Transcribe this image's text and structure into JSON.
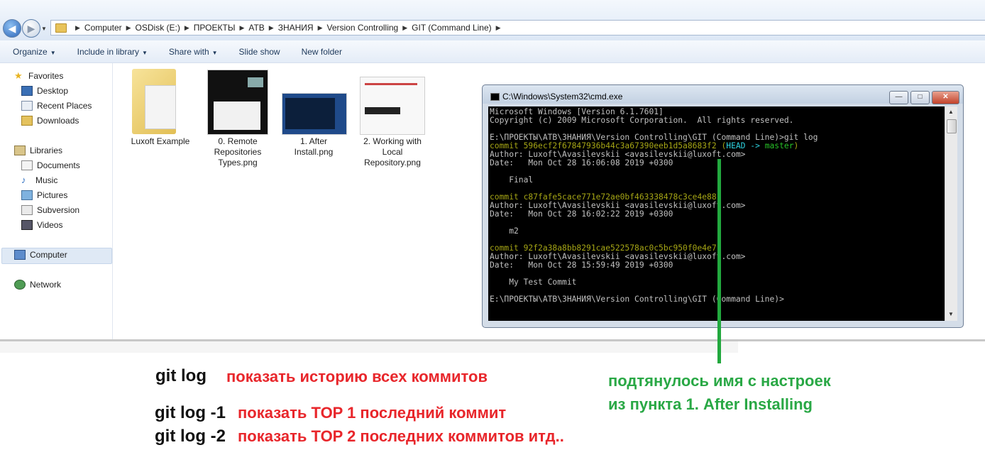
{
  "explorer": {
    "breadcrumb": [
      "Computer",
      "OSDisk (E:)",
      "ПРОЕКТЫ",
      "АТВ",
      "ЗНАНИЯ",
      "Version Controlling",
      "GIT (Command Line)"
    ],
    "toolbar": {
      "organize": "Organize",
      "include_in_library": "Include in library",
      "share_with": "Share with",
      "slide_show": "Slide show",
      "new_folder": "New folder"
    },
    "sidebar": {
      "favorites": "Favorites",
      "desktop": "Desktop",
      "recent_places": "Recent Places",
      "downloads": "Downloads",
      "libraries": "Libraries",
      "documents": "Documents",
      "music": "Music",
      "pictures": "Pictures",
      "subversion": "Subversion",
      "videos": "Videos",
      "computer": "Computer",
      "network": "Network"
    },
    "files": {
      "f0": {
        "line1": "Luxoft Example",
        "line2": "",
        "line3": ""
      },
      "f1": {
        "line1": "0. Remote",
        "line2": "Repositories",
        "line3": "Types.png"
      },
      "f2": {
        "line1": "1. After",
        "line2": "Install.png",
        "line3": ""
      },
      "f3": {
        "line1": "2. Working with",
        "line2": "Local",
        "line3": "Repository.png"
      }
    }
  },
  "cmd": {
    "title": "C:\\Windows\\System32\\cmd.exe",
    "lines": {
      "l1": "Microsoft Windows [Version 6.1.7601]",
      "l2": "Copyright (c) 2009 Microsoft Corporation.  All rights reserved.",
      "l3": "E:\\ПРОЕКТЫ\\АТВ\\ЗНАНИЯ\\Version Controlling\\GIT (Command Line)>git log",
      "c1_hash": "commit 596ecf2f67847936b44c3a67390eeb1d5a8683f2 (",
      "c1_head": "HEAD -> ",
      "c1_master": "master",
      "c1_close": ")",
      "a1": "Author: Luxoft\\Avasilevskii <avasilevskii@luxoft.com>",
      "d1": "Date:   Mon Oct 28 16:06:08 2019 +0300",
      "m1": "    Final",
      "c2": "commit c87fafe5cace771e72ae0bf463338478c3ce4e88",
      "a2": "Author: Luxoft\\Avasilevskii <avasilevskii@luxoft.com>",
      "d2": "Date:   Mon Oct 28 16:02:22 2019 +0300",
      "m2": "    m2",
      "c3": "commit 92f2a38a8bb8291cae522578ac0c5bc950f0e4e7",
      "a3": "Author: Luxoft\\Avasilevskii <avasilevskii@luxoft.com>",
      "d3": "Date:   Mon Oct 28 15:59:49 2019 +0300",
      "m3": "    My Test Commit",
      "prompt": "E:\\ПРОЕКТЫ\\АТВ\\ЗНАНИЯ\\Version Controlling\\GIT (Command Line)>"
    },
    "colors": {
      "yellow": "#a6a615",
      "cyan": "#2dd2e0",
      "green": "#27c227"
    }
  },
  "notes": {
    "git_log": "git log",
    "git_log_desc": "показать историю всех коммитов",
    "git_log1": "git log -1",
    "git_log1_desc": "показать TOP 1 последний коммит",
    "git_log2": "git log -2",
    "git_log2_desc": "показать TOP 2 последних коммитов итд..",
    "green_note1": "подтянулось имя с настроек",
    "green_note2": "из пункта 1. After Installing",
    "colors": {
      "red": "#e8262b",
      "green": "#29a845"
    }
  }
}
